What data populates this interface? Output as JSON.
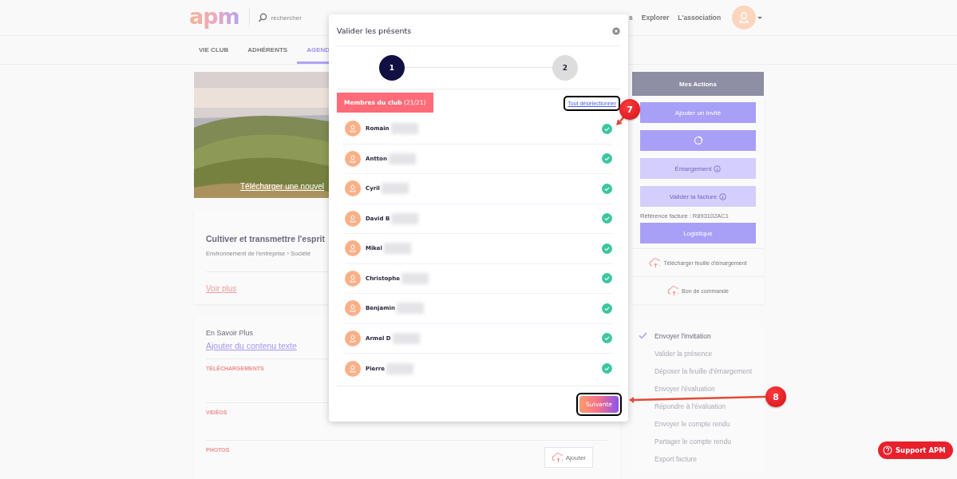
{
  "header": {
    "logo": "apm",
    "search": {
      "placeholder": "rechercher"
    },
    "nav": [
      {
        "label": "s"
      },
      {
        "label": "Explorer"
      },
      {
        "label": "L'association"
      }
    ]
  },
  "tabs": [
    {
      "label": "VIE CLUB",
      "selected": false
    },
    {
      "label": "ADHÉRENTS",
      "selected": false
    },
    {
      "label": "AGEND",
      "selected": true
    }
  ],
  "cover": {
    "kind": "picture",
    "link": "Télécharger une nouvel"
  },
  "project_card": {
    "title": "Cultiver et transmettre l'esprit",
    "breadcrumb": "Environnement de l'entreprise › Société",
    "link": "Voir plus"
  },
  "info_card": {
    "title": "En Savoir Plus",
    "link": "Ajouter du contenu texte",
    "sections": [
      {
        "label": "TÉLÉCHARGEMENTS"
      },
      {
        "label": "VIDÉOS"
      },
      {
        "label": "PHOTOS",
        "button": "Ajouter"
      }
    ]
  },
  "actions": {
    "title": "Mes Actions",
    "buttons": [
      {
        "kind": "text",
        "label": "Ajouter un invité",
        "disabled": false
      },
      {
        "kind": "spinner",
        "disabled": false
      },
      {
        "kind": "info",
        "label": "Émargement",
        "disabled": true
      },
      {
        "kind": "info",
        "label": "Valider la facture",
        "disabled": true
      }
    ],
    "reference": "Référence facture : R893102AC1",
    "logistics": "Logistique",
    "downloads": [
      "Télécharger feuille d'émargement",
      "Bon de commande"
    ]
  },
  "progress_steps": [
    {
      "label": "Envoyer l'invitation",
      "done": true
    },
    {
      "label": "Valider la présence",
      "done": false
    },
    {
      "label": "Déposer la feuille d'émargement",
      "done": false
    },
    {
      "label": "Envoyer l'évaluation",
      "done": false
    },
    {
      "label": "Répondre à l'évaluation",
      "done": false
    },
    {
      "label": "Envoyer le compte rendu",
      "done": false
    },
    {
      "label": "Partager le compte rendu",
      "done": false
    },
    {
      "label": "Export facture",
      "done": false
    }
  ],
  "support": "Support APM",
  "modal": {
    "title": "Valider les présents",
    "steps": [
      {
        "label": "1",
        "active": true
      },
      {
        "label": "2",
        "active": false
      }
    ],
    "members_tab": "**Membres du club** (21/21)",
    "deselect_all": "Tout désélectionner",
    "members": [
      {
        "name": "Romain",
        "selected": true
      },
      {
        "name": "Antton",
        "selected": true
      },
      {
        "name": "Cyril",
        "selected": true
      },
      {
        "name": "David B",
        "selected": true
      },
      {
        "name": "Mikel",
        "selected": true
      },
      {
        "name": "Christophe",
        "selected": true
      },
      {
        "name": "Benjamin",
        "selected": true
      },
      {
        "name": "Armel D",
        "selected": true
      },
      {
        "name": "Pierre",
        "selected": true
      }
    ],
    "next": "Suivante"
  },
  "annotations": [
    {
      "label": "7"
    },
    {
      "label": "8"
    }
  ]
}
